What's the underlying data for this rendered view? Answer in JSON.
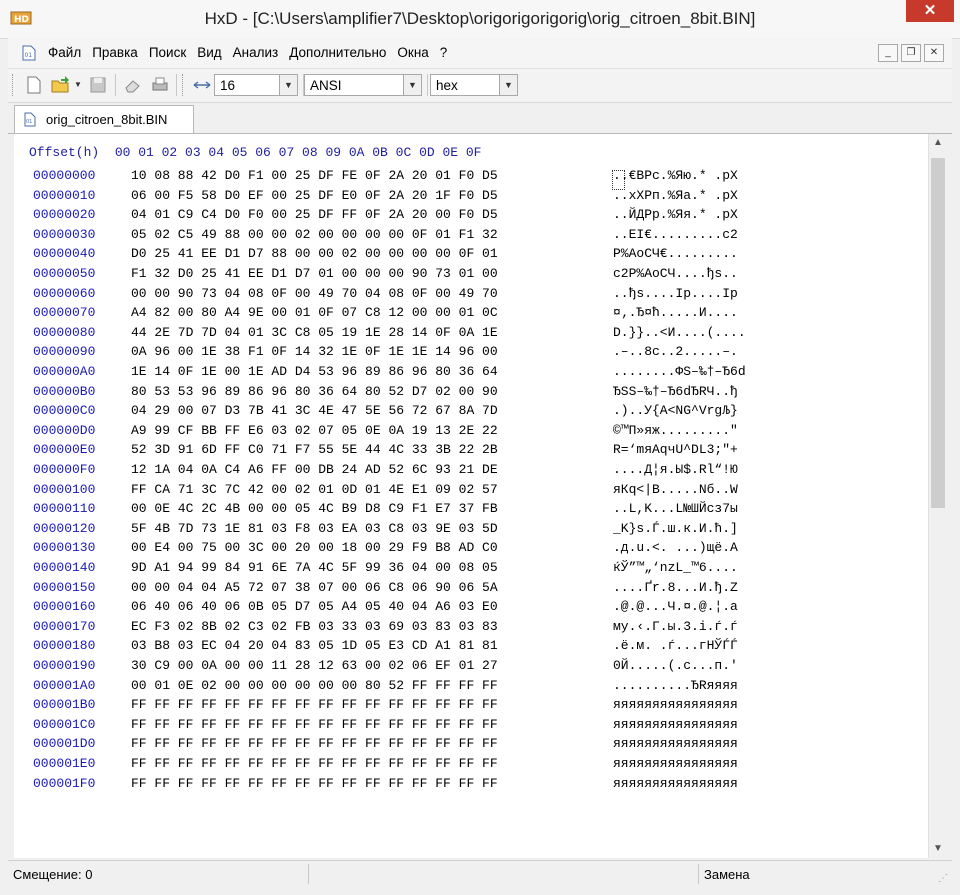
{
  "window": {
    "title": "HxD - [C:\\Users\\amplifier7\\Desktop\\origorigorigorig\\orig_citroen_8bit.BIN]",
    "close_glyph": "✕"
  },
  "menu": {
    "items": [
      "Файл",
      "Правка",
      "Поиск",
      "Вид",
      "Анализ",
      "Дополнительно",
      "Окна",
      "?"
    ],
    "mdi_buttons": [
      "_",
      "❐",
      "✕"
    ]
  },
  "toolbar": {
    "icons": [
      "new-file-icon",
      "open-folder-icon",
      "save-icon",
      "eraser-icon",
      "print-icon",
      "bytes-per-row-icon"
    ],
    "bytes_per_row": "16",
    "charset": "ANSI",
    "offset_base": "hex"
  },
  "tab": {
    "label": "orig_citroen_8bit.BIN"
  },
  "hex": {
    "header": "Offset(h)  00 01 02 03 04 05 06 07 08 09 0A 0B 0C 0D 0E 0F",
    "rows": [
      {
        "offset": "00000000",
        "bytes": "10 08 88 42 D0 F1 00 25 DF FE 0F 2A 20 01 F0 D5",
        "text": "..€BPс.%Яю.* .рХ"
      },
      {
        "offset": "00000010",
        "bytes": "06 00 F5 58 D0 EF 00 25 DF E0 0F 2A 20 1F F0 D5",
        "text": "..хXPп.%Яа.* .рХ"
      },
      {
        "offset": "00000020",
        "bytes": "04 01 C9 C4 D0 F0 00 25 DF FF 0F 2A 20 00 F0 D5",
        "text": "..ЙДPр.%Яя.* .рХ"
      },
      {
        "offset": "00000030",
        "bytes": "05 02 C5 49 88 00 00 02 00 00 00 00 0F 01 F1 32",
        "text": "..ЕI€.........с2"
      },
      {
        "offset": "00000040",
        "bytes": "D0 25 41 EE D1 D7 88 00 00 02 00 00 00 00 0F 01",
        "text": "Р%AоСЧ€........."
      },
      {
        "offset": "00000050",
        "bytes": "F1 32 D0 25 41 EE D1 D7 01 00 00 00 90 73 01 00",
        "text": "с2Р%AоСЧ....ђs.."
      },
      {
        "offset": "00000060",
        "bytes": "00 00 90 73 04 08 0F 00 49 70 04 08 0F 00 49 70",
        "text": "..ђs....Ip....Ip"
      },
      {
        "offset": "00000070",
        "bytes": "A4 82 00 80 A4 9E 00 01 0F 07 C8 12 00 00 01 0C",
        "text": "¤‚.Ђ¤ћ.....И...."
      },
      {
        "offset": "00000080",
        "bytes": "44 2E 7D 7D 04 01 3C C8 05 19 1E 28 14 0F 0A 1E",
        "text": "D.}}..<И....(...."
      },
      {
        "offset": "00000090",
        "bytes": "0A 96 00 1E 38 F1 0F 14 32 1E 0F 1E 1E 14 96 00",
        "text": ".–..8с..2.....–."
      },
      {
        "offset": "000000A0",
        "bytes": "1E 14 0F 1E 00 1E AD D4 53 96 89 86 96 80 36 64",
        "text": "........ФS–‰†–Ђ6d"
      },
      {
        "offset": "000000B0",
        "bytes": "80 53 53 96 89 86 96 80 36 64 80 52 D7 02 00 90",
        "text": "ЂSS–‰†–Ђ6dЂRЧ..ђ"
      },
      {
        "offset": "000000C0",
        "bytes": "04 29 00 07 D3 7B 41 3C 4E 47 5E 56 72 67 8A 7D",
        "text": ".)..У{A<NG^VrgЉ}"
      },
      {
        "offset": "000000D0",
        "bytes": "A9 99 CF BB FF E6 03 02 07 05 0E 0A 19 13 2E 22",
        "text": "©™П»яж.........\""
      },
      {
        "offset": "000000E0",
        "bytes": "52 3D 91 6D FF C0 71 F7 55 5E 44 4C 33 3B 22 2B",
        "text": "R=‘mяАqчU^DL3;\"+"
      },
      {
        "offset": "000000F0",
        "bytes": "12 1A 04 0A C4 A6 FF 00 DB 24 AD 52 6C 93 21 DE",
        "text": "....Д¦я.Ы$.Rl“!Ю"
      },
      {
        "offset": "00000100",
        "bytes": "FF CA 71 3C 7C 42 00 02 01 0D 01 4E E1 09 02 57",
        "text": "яКq<|B.....Nб..W"
      },
      {
        "offset": "00000110",
        "bytes": "00 0E 4C 2C 4B 00 00 05 4C B9 D8 C9 F1 E7 37 FB",
        "text": "..L,K...L№ШЙсз7ы"
      },
      {
        "offset": "00000120",
        "bytes": "5F 4B 7D 73 1E 81 03 F8 03 EA 03 C8 03 9E 03 5D",
        "text": "_K}s.Ѓ.ш.к.И.ћ.]"
      },
      {
        "offset": "00000130",
        "bytes": "00 E4 00 75 00 3C 00 20 00 18 00 29 F9 B8 AD C0",
        "text": ".д.u.<. ...)щё.А"
      },
      {
        "offset": "00000140",
        "bytes": "9D A1 94 99 84 91 6E 7A 4C 5F 99 36 04 00 08 05",
        "text": "ќЎ”™„‘nzL_™6...."
      },
      {
        "offset": "00000150",
        "bytes": "00 00 04 04 A5 72 07 38 07 00 06 C8 06 90 06 5A",
        "text": "....Ґr.8...И.ђ.Z"
      },
      {
        "offset": "00000160",
        "bytes": "06 40 06 40 06 0B 05 D7 05 A4 05 40 04 A6 03 E0",
        "text": ".@.@...Ч.¤.@.¦.а"
      },
      {
        "offset": "00000170",
        "bytes": "EC F3 02 8B 02 C3 02 FB 03 33 03 69 03 83 03 83",
        "text": "му.‹.Г.ы.3.i.ѓ.ѓ"
      },
      {
        "offset": "00000180",
        "bytes": "03 B8 03 EC 04 20 04 83 05 1D 05 E3 CD A1 81 81",
        "text": ".ё.м. .ѓ...гНЎЃЃ"
      },
      {
        "offset": "00000190",
        "bytes": "30 C9 00 0A 00 00 11 28 12 63 00 02 06 EF 01 27",
        "text": "0Й.....(.c...п.'"
      },
      {
        "offset": "000001A0",
        "bytes": "00 01 0E 02 00 00 00 00 00 00 80 52 FF FF FF FF",
        "text": "..........ЂRяяяя"
      },
      {
        "offset": "000001B0",
        "bytes": "FF FF FF FF FF FF FF FF FF FF FF FF FF FF FF FF",
        "text": "яяяяяяяяяяяяяяяя"
      },
      {
        "offset": "000001C0",
        "bytes": "FF FF FF FF FF FF FF FF FF FF FF FF FF FF FF FF",
        "text": "яяяяяяяяяяяяяяяя"
      },
      {
        "offset": "000001D0",
        "bytes": "FF FF FF FF FF FF FF FF FF FF FF FF FF FF FF FF",
        "text": "яяяяяяяяяяяяяяяя"
      },
      {
        "offset": "000001E0",
        "bytes": "FF FF FF FF FF FF FF FF FF FF FF FF FF FF FF FF",
        "text": "яяяяяяяяяяяяяяяя"
      },
      {
        "offset": "000001F0",
        "bytes": "FF FF FF FF FF FF FF FF FF FF FF FF FF FF FF FF",
        "text": "яяяяяяяяяяяяяяяя"
      }
    ]
  },
  "status": {
    "offset": "Смещение: 0",
    "mode": "Замена"
  },
  "colors": {
    "offset_color": "#1a1ab8",
    "close_button": "#c7392b"
  }
}
